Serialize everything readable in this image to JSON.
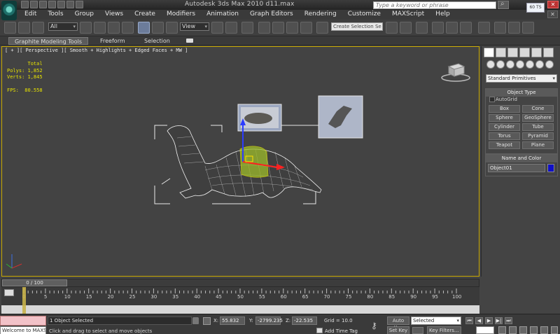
{
  "window": {
    "title": "Autodesk 3ds Max  2010        d11.max",
    "search_placeholder": "Type a keyword or phrase",
    "close_label": "✕",
    "popup_text": "60 TS"
  },
  "menu": {
    "items": [
      "Edit",
      "Tools",
      "Group",
      "Views",
      "Create",
      "Modifiers",
      "Animation",
      "Graph Editors",
      "Rendering",
      "Customize",
      "MAXScript",
      "Help"
    ],
    "doc_close": "✕"
  },
  "toolbar": {
    "filter_value": "All",
    "coord_value": "View",
    "selection_set_placeholder": "Create Selection Se"
  },
  "ribbon": {
    "tabs": [
      "Graphite Modeling Tools",
      "Freeform",
      "Selection"
    ]
  },
  "viewport": {
    "label": "[ + ][ Perspective ][ Smooth + Highlights + Edged Faces + MW ]",
    "stats_text": "       Total\nPolys: 1,852\nVerts: 1,845\n\nFPS:  80.558"
  },
  "command_panel": {
    "dropdown_value": "Standard Primitives",
    "object_type_title": "Object Type",
    "autogrid_label": "AutoGrid",
    "buttons": [
      "Box",
      "Cone",
      "Sphere",
      "GeoSphere",
      "Cylinder",
      "Tube",
      "Torus",
      "Pyramid",
      "Teapot",
      "Plane"
    ],
    "name_color_title": "Name and Color",
    "object_name": "Object01",
    "object_color": "#1010c8"
  },
  "timeline": {
    "slider_text": "0 / 100",
    "ticks": [
      "0",
      "5",
      "10",
      "15",
      "20",
      "25",
      "30",
      "35",
      "40",
      "45",
      "50",
      "55",
      "60",
      "65",
      "70",
      "75",
      "80",
      "85",
      "90",
      "95",
      "100"
    ]
  },
  "status": {
    "maxscript_output": "Welcome to MAXS",
    "selection_status": "1 Object Selected",
    "prompt": "Click and drag to select and move objects",
    "x_label": "X:",
    "x_value": "55.832",
    "y_label": "Y:",
    "y_value": "-2799.235",
    "z_label": "Z:",
    "z_value": "-22.535",
    "grid": "Grid = 10.0",
    "add_time_tag": "Add Time Tag",
    "auto_key": "Auto Key",
    "set_key": "Set Key",
    "selected_value": "Selected",
    "key_filters": "Key Filters...",
    "playback": [
      "⏮",
      "◀",
      "▶",
      "▶|",
      "⏭"
    ]
  }
}
